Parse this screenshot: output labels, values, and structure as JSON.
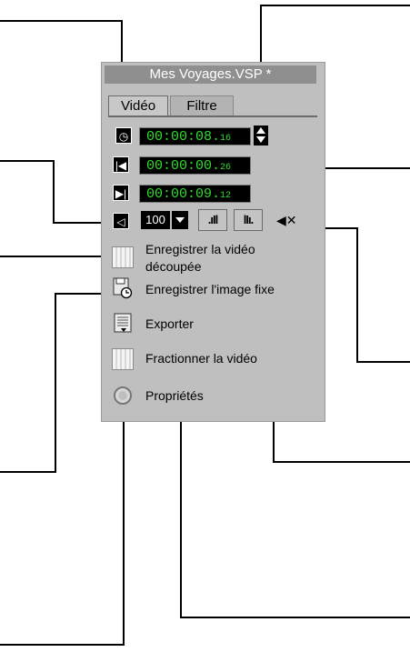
{
  "window": {
    "title": "Mes Voyages.VSP *"
  },
  "tabs": [
    {
      "label": "Vidéo",
      "active": true
    },
    {
      "label": "Filtre",
      "active": false
    }
  ],
  "timecodes": {
    "duration": {
      "main": "00:00:08.",
      "frames": "16",
      "icon": "clock-icon"
    },
    "mark_in": {
      "main": "00:00:00.",
      "frames": "26",
      "icon": "mark-in-icon"
    },
    "mark_out": {
      "main": "00:00:09.",
      "frames": "12",
      "icon": "mark-out-icon"
    }
  },
  "volume": {
    "value": "100",
    "icon": "speaker-icon"
  },
  "audio_buttons": {
    "fade_in_icon": "fade-in-icon",
    "fade_out_icon": "fade-out-icon",
    "mute_icon": "mute-icon"
  },
  "commands": [
    {
      "label_line1": "Enregistrer la vidéo",
      "label_line2": "découpée",
      "icon": "film-save-icon"
    },
    {
      "label": "Enregistrer l'image fixe",
      "icon": "save-still-icon"
    },
    {
      "label": "Exporter",
      "icon": "export-icon"
    },
    {
      "label": "Fractionner la vidéo",
      "icon": "split-film-icon"
    },
    {
      "label": "Propriétés",
      "icon": "properties-icon"
    }
  ],
  "colors": {
    "panel": "#bfbfbf",
    "title_bar": "#8f8f8f",
    "timecode_bg": "#000000",
    "timecode_text": "#2fdc2f"
  }
}
